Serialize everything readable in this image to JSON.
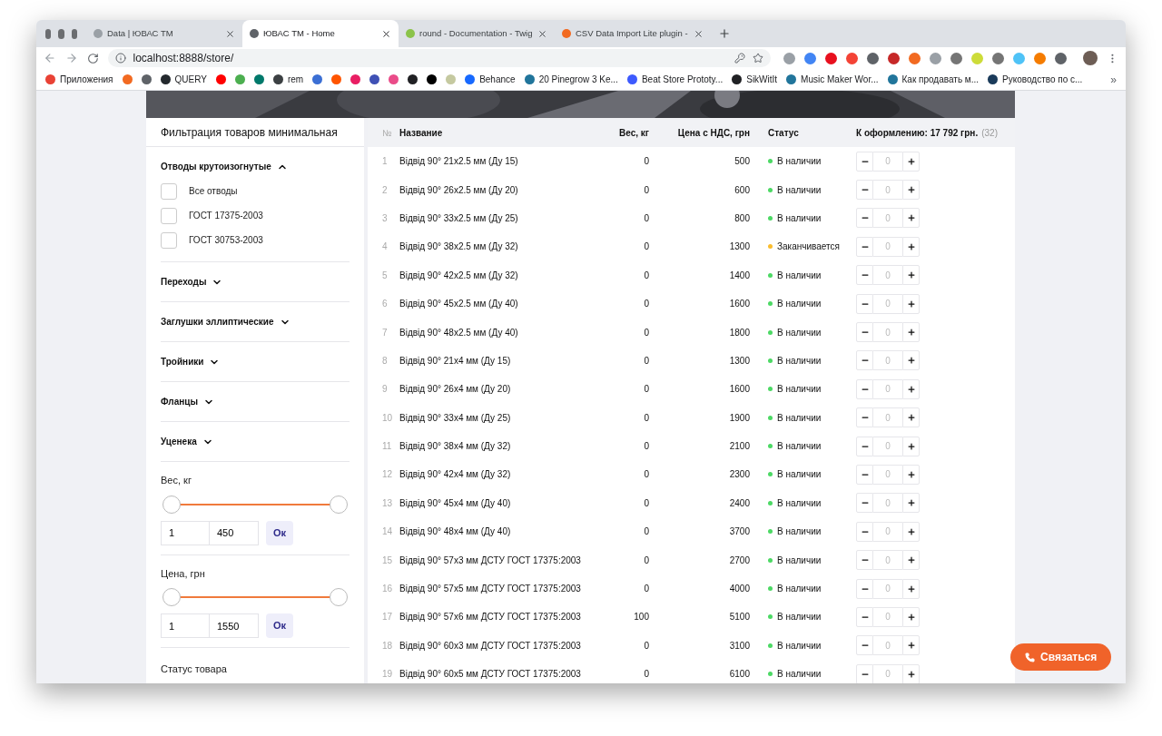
{
  "browser": {
    "tabs": [
      {
        "title": "Data | ЮВАС ТМ",
        "selected": false,
        "color": "#9aa0a6"
      },
      {
        "title": "ЮВАС ТМ - Home",
        "selected": true,
        "color": "#5f6368"
      },
      {
        "title": "round - Documentation - Twig",
        "selected": false,
        "color": "#8bc34a"
      },
      {
        "title": "CSV Data Import Lite plugin -",
        "selected": false,
        "color": "#f26a21"
      }
    ],
    "address": "localhost:8888/store/",
    "bookmarks": [
      {
        "label": "Приложения",
        "color": "#e94235"
      },
      {
        "color": "#f26a21"
      },
      {
        "color": "#5f6368"
      },
      {
        "label": "QUERY",
        "color": "#24292e"
      },
      {
        "color": "#ff0000"
      },
      {
        "color": "#4caf50"
      },
      {
        "color": "#00796b"
      },
      {
        "label": "rem",
        "color": "#3c4043"
      },
      {
        "color": "#3b6fd4"
      },
      {
        "color": "#ff5500"
      },
      {
        "color": "#e91e63"
      },
      {
        "color": "#3f51b5"
      },
      {
        "color": "#ea4c89"
      },
      {
        "color": "#202124"
      },
      {
        "color": "#000000"
      },
      {
        "color": "#c5c9a0"
      },
      {
        "label": "Behance",
        "color": "#1769ff"
      },
      {
        "label": "20 Pinegrow 3 Ke...",
        "color": "#21759b"
      },
      {
        "label": "Beat Store Prototy...",
        "color": "#3d5afe"
      },
      {
        "label": "SikWitIt",
        "color": "#202124"
      },
      {
        "label": "Music Maker Wor...",
        "color": "#21759b"
      },
      {
        "label": "Как продавать м...",
        "color": "#21759b"
      },
      {
        "label": "Руководство по с...",
        "color": "#1a3a5a"
      }
    ],
    "bookmarks_more": "»"
  },
  "sidebar": {
    "title": "Фильтрация товаров минимальная",
    "sections": [
      {
        "title": "Отводы крутоизогнутые",
        "expanded": true,
        "options": [
          {
            "label": "Все отводы",
            "checked": false
          },
          {
            "label": "ГОСТ 17375-2003",
            "checked": false
          },
          {
            "label": "ГОСТ 30753-2003",
            "checked": false
          }
        ]
      },
      {
        "title": "Переходы",
        "expanded": false
      },
      {
        "title": "Заглушки эллиптические",
        "expanded": false
      },
      {
        "title": "Тройники",
        "expanded": false
      },
      {
        "title": "Фланцы",
        "expanded": false
      },
      {
        "title": "Уценека",
        "expanded": false
      }
    ],
    "ranges": [
      {
        "label": "Вес, кг",
        "thumbs": [
          {
            "level": 0
          },
          {
            "level": 1
          }
        ],
        "min": "1",
        "max": "450",
        "button": "Ок"
      },
      {
        "label": "Цена, грн",
        "thumbs": [
          {
            "level": 0
          },
          {
            "level": 1
          }
        ],
        "min": "1",
        "max": "1550",
        "button": "Ок"
      }
    ],
    "status_label": "Статус товара"
  },
  "table": {
    "columns": [
      "№",
      "Название",
      "Вес, кг",
      "Цена с НДС, грн",
      "Статус"
    ],
    "cart_total": "К оформлению: 17 792 грн.",
    "cart_count": "(32)",
    "rows": [
      {
        "n": "1",
        "name": "Відвід 90° 21x2.5 мм (Ду 15)",
        "weight": "0",
        "price": "500",
        "status": "В наличии",
        "color": "#4cd964",
        "qty": "0"
      },
      {
        "n": "2",
        "name": "Відвід 90° 26x2.5 мм (Ду 20)",
        "weight": "0",
        "price": "600",
        "status": "В наличии",
        "color": "#4cd964",
        "qty": "0"
      },
      {
        "n": "3",
        "name": "Відвід 90° 33x2.5 мм (Ду 25)",
        "weight": "0",
        "price": "800",
        "status": "В наличии",
        "color": "#4cd964",
        "qty": "0"
      },
      {
        "n": "4",
        "name": "Відвід 90° 38x2.5 мм (Ду 32)",
        "weight": "0",
        "price": "1300",
        "status": "Заканчивается",
        "color": "#fbbd2e",
        "qty": "0"
      },
      {
        "n": "5",
        "name": "Відвід 90° 42x2.5 мм (Ду 32)",
        "weight": "0",
        "price": "1400",
        "status": "В наличии",
        "color": "#4cd964",
        "qty": "0"
      },
      {
        "n": "6",
        "name": "Відвід 90° 45x2.5 мм (Ду 40)",
        "weight": "0",
        "price": "1600",
        "status": "В наличии",
        "color": "#4cd964",
        "qty": "0"
      },
      {
        "n": "7",
        "name": "Відвід 90° 48x2.5 мм (Ду 40)",
        "weight": "0",
        "price": "1800",
        "status": "В наличии",
        "color": "#4cd964",
        "qty": "0"
      },
      {
        "n": "8",
        "name": "Відвід 90° 21x4 мм (Ду 15)",
        "weight": "0",
        "price": "1300",
        "status": "В наличии",
        "color": "#4cd964",
        "qty": "0"
      },
      {
        "n": "9",
        "name": "Відвід 90° 26x4 мм (Ду 20)",
        "weight": "0",
        "price": "1600",
        "status": "В наличии",
        "color": "#4cd964",
        "qty": "0"
      },
      {
        "n": "10",
        "name": "Відвід 90° 33x4 мм (Ду 25)",
        "weight": "0",
        "price": "1900",
        "status": "В наличии",
        "color": "#4cd964",
        "qty": "0"
      },
      {
        "n": "11",
        "name": "Відвід 90° 38x4 мм (Ду 32)",
        "weight": "0",
        "price": "2100",
        "status": "В наличии",
        "color": "#4cd964",
        "qty": "0"
      },
      {
        "n": "12",
        "name": "Відвід 90° 42x4 мм (Ду 32)",
        "weight": "0",
        "price": "2300",
        "status": "В наличии",
        "color": "#4cd964",
        "qty": "0"
      },
      {
        "n": "13",
        "name": "Відвід 90° 45x4 мм (Ду 40)",
        "weight": "0",
        "price": "2400",
        "status": "В наличии",
        "color": "#4cd964",
        "qty": "0"
      },
      {
        "n": "14",
        "name": "Відвід 90° 48x4 мм (Ду 40)",
        "weight": "0",
        "price": "3700",
        "status": "В наличии",
        "color": "#4cd964",
        "qty": "0"
      },
      {
        "n": "15",
        "name": "Відвід 90° 57x3 мм ДСТУ ГОСТ 17375:2003",
        "weight": "0",
        "price": "2700",
        "status": "В наличии",
        "color": "#4cd964",
        "qty": "0"
      },
      {
        "n": "16",
        "name": "Відвід 90° 57x5 мм ДСТУ ГОСТ 17375:2003",
        "weight": "0",
        "price": "4000",
        "status": "В наличии",
        "color": "#4cd964",
        "qty": "0"
      },
      {
        "n": "17",
        "name": "Відвід 90° 57x6 мм ДСТУ ГОСТ 17375:2003",
        "weight": "100",
        "price": "5100",
        "status": "В наличии",
        "color": "#4cd964",
        "qty": "0"
      },
      {
        "n": "18",
        "name": "Відвід 90° 60x3 мм ДСТУ ГОСТ 17375:2003",
        "weight": "0",
        "price": "3100",
        "status": "В наличии",
        "color": "#4cd964",
        "qty": "0"
      },
      {
        "n": "19",
        "name": "Відвід 90° 60x5 мм ДСТУ ГОСТ 17375:2003",
        "weight": "0",
        "price": "6100",
        "status": "В наличии",
        "color": "#4cd964",
        "qty": "0"
      }
    ]
  },
  "contact_button": "Связаться"
}
